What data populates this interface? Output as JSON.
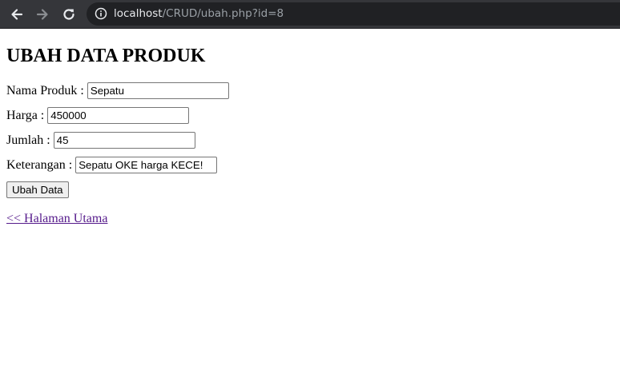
{
  "browser": {
    "url_host": "localhost",
    "url_path": "/CRUD/ubah.php?id=8",
    "icons": [
      "back-arrow-icon",
      "forward-arrow-icon",
      "reload-icon",
      "info-icon"
    ]
  },
  "page": {
    "title": "UBAH DATA PRODUK",
    "fields": [
      {
        "label": "Nama Produk :",
        "value": "Sepatu"
      },
      {
        "label": "Harga :",
        "value": "450000"
      },
      {
        "label": "Jumlah :",
        "value": "45"
      },
      {
        "label": "Keterangan :",
        "value": "Sepatu OKE harga KECE!"
      }
    ],
    "submit_label": "Ubah Data",
    "back_link": "<< Halaman Utama"
  },
  "colors": {
    "toolbar_bg": "#35363a",
    "omnibox_bg": "#202124",
    "visited_link": "#551a8b"
  }
}
